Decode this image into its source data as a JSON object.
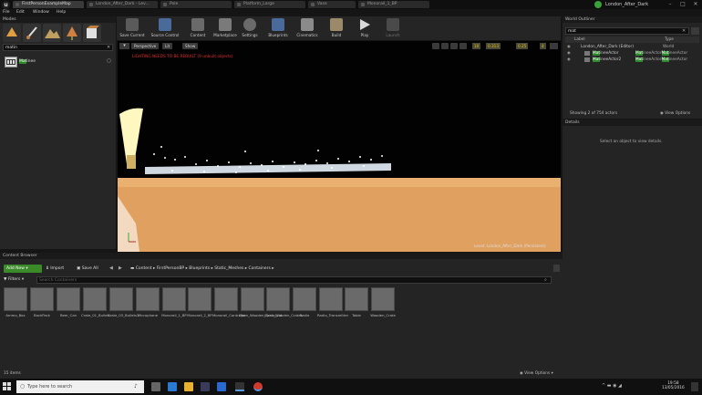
{
  "window": {
    "tabs": [
      "FirstPersonExampleMap",
      "London_After_Dark - Lev...",
      "Pole",
      "Platform_Large",
      "Vase",
      "Monorail_1_BP"
    ],
    "project_name": "London_After_Dark",
    "minimize": "–",
    "maximize": "□",
    "close": "✕"
  },
  "menu": [
    "File",
    "Edit",
    "Window",
    "Help"
  ],
  "modes": {
    "title": "Modes",
    "search_value": "matin",
    "result_label": "Matinee",
    "result_match": "Mat"
  },
  "toolbar": {
    "buttons": [
      "Save Current",
      "Source Control",
      "Content",
      "Marketplace",
      "Settings",
      "Blueprints",
      "Cinematics",
      "Build",
      "Play",
      "Launch"
    ]
  },
  "viewport": {
    "perspective": "Perspective",
    "lit": "Lit",
    "show": "Show",
    "warning": "LIGHTING NEEDS TO BE REBUILT (9 unbuilt objects)",
    "grid_snap": "10",
    "rotation_snap": "10°",
    "scale_snap": "0.25",
    "camera_speed": "4",
    "level_label": "Level:",
    "level_name": "London_After_Dark (Persistent)",
    "fov": "0.313"
  },
  "world_outliner": {
    "title": "World Outliner",
    "search_value": "mat",
    "col_label": "Label",
    "col_type": "Type",
    "rows": [
      {
        "label": "London_After_Dark (Editor)",
        "type": "World"
      },
      {
        "label_pre": "",
        "label_hl": "Mat",
        "label_post": "ineeActor",
        "type_pre": "",
        "type_hl": "Mat",
        "type_mid": "ineeActor",
        "type_hl2": "Mat",
        "type_post": "ineeActor"
      },
      {
        "label_pre": "",
        "label_hl": "Mat",
        "label_post": "ineeActor2",
        "type_pre": "",
        "type_hl": "Mat",
        "type_mid": "ineeActor",
        "type_hl2": "Mat",
        "type_post": "ineeActor"
      }
    ],
    "showing": "Showing 2 of 754 actors",
    "view_options": "View Options"
  },
  "details": {
    "title": "Details",
    "empty_text": "Select an object to view details."
  },
  "content_browser": {
    "title": "Content Browser",
    "add_new": "Add New",
    "import": "Import",
    "save_all": "Save All",
    "path": [
      "Content",
      "FirstPersonBP",
      "Blueprints",
      "Static_Meshes",
      "Containers"
    ],
    "filters": "Filters",
    "search_placeholder": "Search Containers",
    "assets": [
      "Ammo_Box",
      "BackPack",
      "Beer_Can",
      "Crate_01_Bullets",
      "Crate_03_Bullets1",
      "Microphone",
      "Monorail_1_BP",
      "Monorail_2_BP",
      "Monorail_Controller",
      "Open_Wooden_Crate_Lid",
      "Open_Wooden_Crates",
      "Radio",
      "Radio_Transmitter",
      "Table",
      "Wooden_Crate"
    ],
    "item_count": "15 items",
    "view_options": "View Options"
  },
  "taskbar": {
    "search_placeholder": "Type here to search",
    "time": "19:58",
    "date": "13/05/2016"
  }
}
